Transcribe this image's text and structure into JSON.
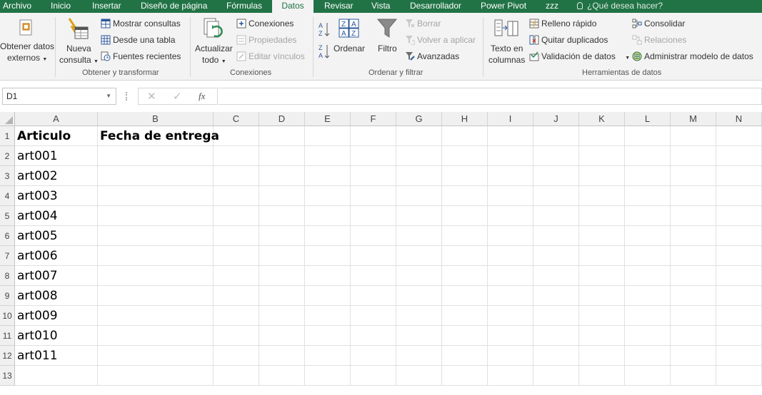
{
  "tabs": [
    "Archivo",
    "Inicio",
    "Insertar",
    "Diseño de página",
    "Fórmulas",
    "Datos",
    "Revisar",
    "Vista",
    "Desarrollador",
    "Power Pivot",
    "zzz"
  ],
  "active_tab": "Datos",
  "tell_me": "¿Qué desea hacer?",
  "ribbon": {
    "get_external": [
      "Obtener datos",
      "externos"
    ],
    "new_query": [
      "Nueva",
      "consulta"
    ],
    "show_queries": "Mostrar consultas",
    "from_table": "Desde una tabla",
    "recent_sources": "Fuentes recientes",
    "group_transform": "Obtener y transformar",
    "refresh_all": [
      "Actualizar",
      "todo"
    ],
    "connections": "Conexiones",
    "properties": "Propiedades",
    "edit_links": "Editar vínculos",
    "group_connections": "Conexiones",
    "sort": "Ordenar",
    "filter": "Filtro",
    "clear": "Borrar",
    "reapply": "Volver a aplicar",
    "advanced": "Avanzadas",
    "group_sort": "Ordenar y filtrar",
    "text_to_columns": [
      "Texto en",
      "columnas"
    ],
    "flash_fill": "Relleno rápido",
    "remove_duplicates": "Quitar duplicados",
    "data_validation": "Validación de datos",
    "consolidate": "Consolidar",
    "relationships": "Relaciones",
    "manage_data_model": "Administrar modelo de datos",
    "group_tools": "Herramientas de datos"
  },
  "formula_bar": {
    "name_box": "D1",
    "fx": "fx",
    "formula": ""
  },
  "columns": [
    "A",
    "B",
    "C",
    "D",
    "E",
    "F",
    "G",
    "H",
    "I",
    "J",
    "K",
    "L",
    "M",
    "N"
  ],
  "rows": [
    "1",
    "2",
    "3",
    "4",
    "5",
    "6",
    "7",
    "8",
    "9",
    "10",
    "11",
    "12",
    "13"
  ],
  "cells": {
    "A1": "Articulo",
    "B1": "Fecha de entrega",
    "A2": "art001",
    "A3": "art002",
    "A4": "art003",
    "A5": "art004",
    "A6": "art005",
    "A7": "art006",
    "A8": "art007",
    "A9": "art008",
    "A10": "art009",
    "A11": "art010",
    "A12": "art011"
  },
  "colors": {
    "accent": "#217346",
    "ribbon_bg": "#f3f3f3",
    "grid_line": "#e1e1e1"
  }
}
